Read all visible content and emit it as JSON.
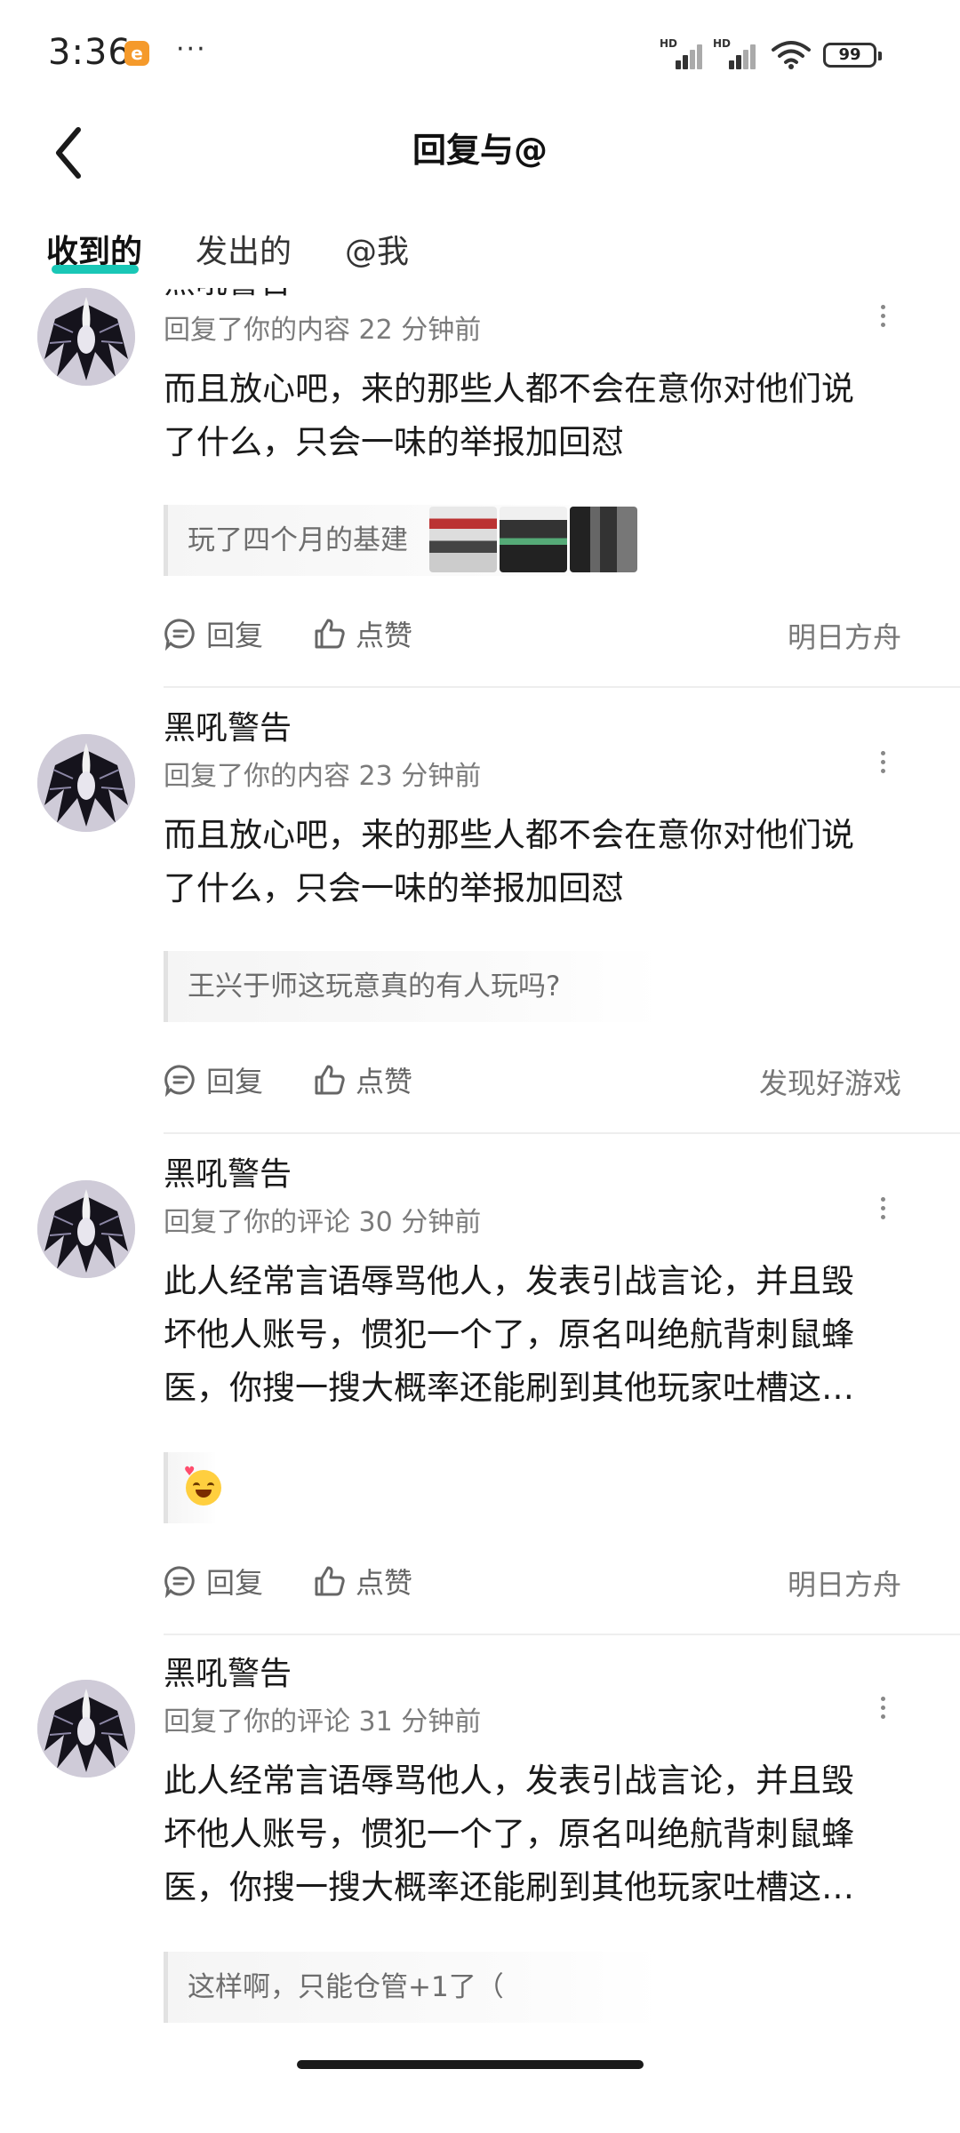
{
  "status_bar": {
    "time": "3:36",
    "app_badge": "e",
    "more": "···",
    "sim_label": "HD",
    "battery": "99"
  },
  "header": {
    "title": "回复与@"
  },
  "tabs": [
    {
      "label": "收到的"
    },
    {
      "label": "发出的"
    },
    {
      "label": "@我"
    }
  ],
  "active_tab": 0,
  "colors": {
    "accent": "#19c7b6",
    "meta_text": "#7b7b7b",
    "battery_badge": "#f59a2b"
  },
  "actions": {
    "reply": "回复",
    "like": "点赞"
  },
  "items": [
    {
      "username": "黑吼警告",
      "meta": "回复了你的内容 22 分钟前",
      "text_lines": [
        "而且放心吧，来的那些人都不会在意你对他们说",
        "了什么，只会一味的举报加回怼"
      ],
      "quote": "玩了四个月的基建",
      "source": "明日方舟"
    },
    {
      "username": "黑吼警告",
      "meta": "回复了你的内容 23 分钟前",
      "text_lines": [
        "而且放心吧，来的那些人都不会在意你对他们说",
        "了什么，只会一味的举报加回怼"
      ],
      "quote": "王兴于师这玩意真的有人玩吗?",
      "source": "发现好游戏"
    },
    {
      "username": "黑吼警告",
      "meta": "回复了你的评论 30 分钟前",
      "text_lines": [
        "此人经常言语辱骂他人，发表引战言论，并且毁",
        "坏他人账号，惯犯一个了，原名叫绝航背刺鼠蜂",
        "医，你搜一搜大概率还能刷到其他玩家吐槽这…"
      ],
      "quote": "",
      "source": "明日方舟"
    },
    {
      "username": "黑吼警告",
      "meta": "回复了你的评论 31 分钟前",
      "text_lines": [
        "此人经常言语辱骂他人，发表引战言论，并且毁",
        "坏他人账号，惯犯一个了，原名叫绝航背刺鼠蜂",
        "医，你搜一搜大概率还能刷到其他玩家吐槽这…"
      ],
      "quote": "这样啊，只能仓管+1了（",
      "source": ""
    }
  ]
}
